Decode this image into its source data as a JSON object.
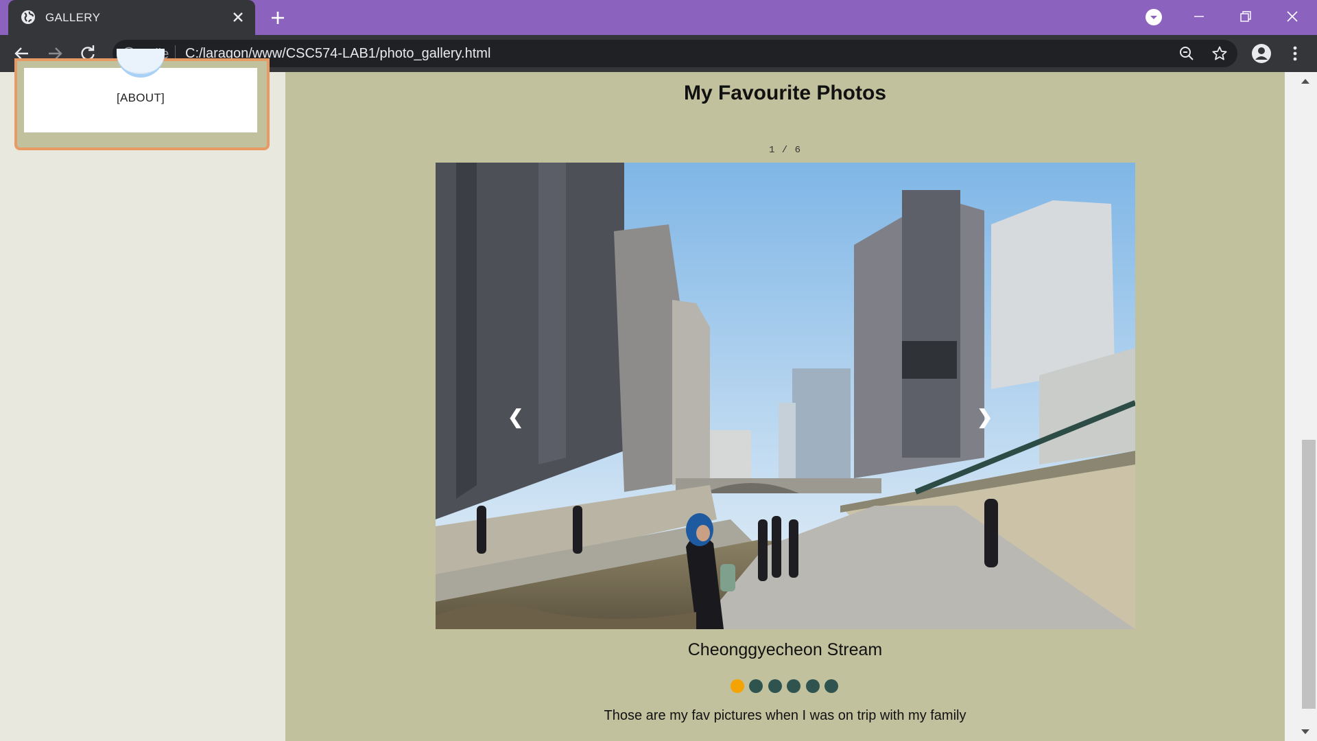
{
  "browser": {
    "tab_title": "GALLERY",
    "url_scheme": "File",
    "url": "C:/laragon/www/CSC574-LAB1/photo_gallery.html",
    "theme_color": "#8b62be",
    "icons": [
      "globe-icon",
      "close-icon",
      "plus-icon",
      "back-arrow-icon",
      "forward-arrow-icon",
      "reload-icon",
      "info-icon",
      "zoom-out-icon",
      "star-icon",
      "account-icon",
      "more-vert-icon"
    ]
  },
  "sidebar": {
    "about_label": "[ABOUT]",
    "card_border_color": "#e89a64"
  },
  "gallery": {
    "title": "My Favourite Photos",
    "counter": "1 / 6",
    "prev_label": "❮",
    "next_label": "❯",
    "caption": "Cheonggyecheon Stream",
    "dots_total": 6,
    "active_dot": 1,
    "active_dot_color": "#f5a300",
    "inactive_dot_color": "#2f5450",
    "description": "Those are my fav pictures when I was on trip with my family"
  }
}
